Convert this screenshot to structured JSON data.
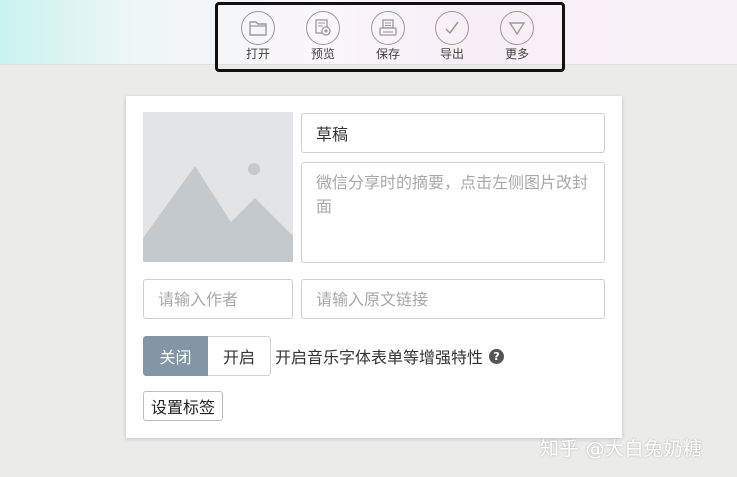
{
  "toolbar": {
    "items": [
      {
        "label": "打开",
        "icon": "folder-icon"
      },
      {
        "label": "预览",
        "icon": "preview-icon"
      },
      {
        "label": "保存",
        "icon": "save-icon"
      },
      {
        "label": "导出",
        "icon": "checkmark-icon"
      },
      {
        "label": "更多",
        "icon": "triangle-down-icon"
      }
    ]
  },
  "editor": {
    "cover_icon": "image-placeholder-icon",
    "title_value": "草稿",
    "summary_placeholder": "微信分享时的摘要，点击左侧图片改封面",
    "author_placeholder": "请输入作者",
    "link_placeholder": "请输入原文链接",
    "toggle_off_label": "关闭",
    "toggle_on_label": "开启",
    "toggle_caption": "开启音乐字体表单等增强特性",
    "help_glyph": "?",
    "tag_button_label": "设置标签"
  },
  "watermark": "知乎 @大白兔奶糖",
  "colors": {
    "toggle_active": "#8296a5",
    "toolbar_frame": "#111111"
  }
}
